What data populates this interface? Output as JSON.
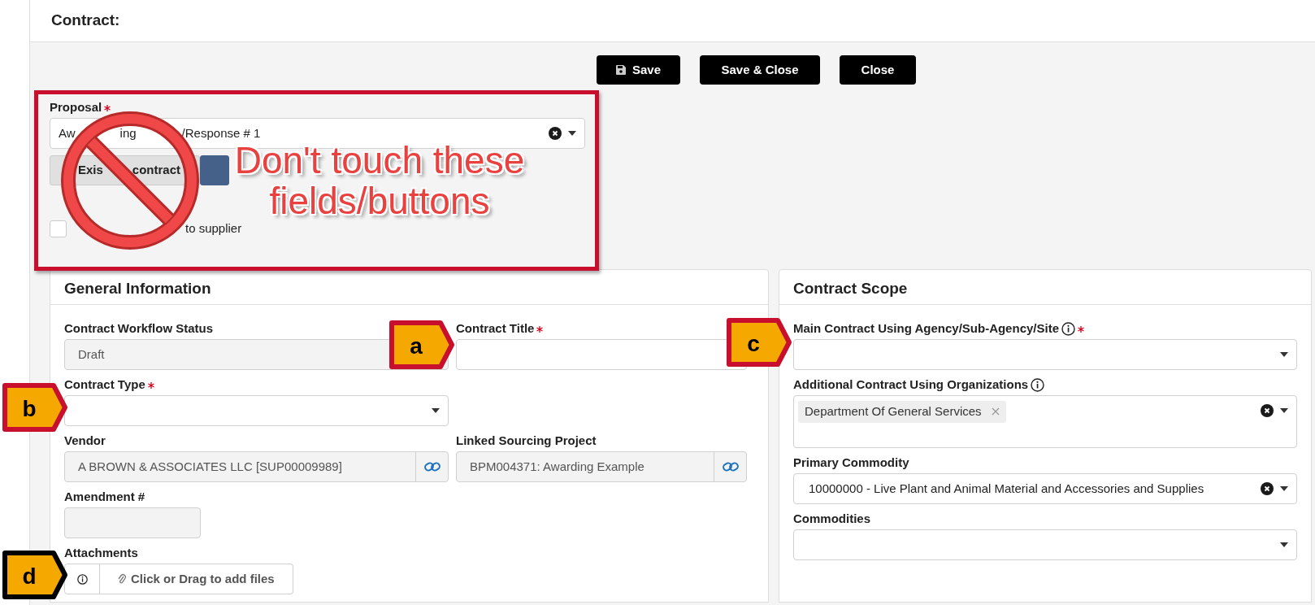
{
  "header": {
    "title": "Contract:"
  },
  "toolbar": {
    "buttons": [
      {
        "label": "Save"
      },
      {
        "label": "Save & Close"
      },
      {
        "label": "Close"
      }
    ]
  },
  "proposal": {
    "label": "Proposal",
    "required": true,
    "value_parts": [
      "Aw",
      "ing",
      "/Response # 1"
    ],
    "clearable": true,
    "mode_buttons": [
      {
        "label_parts": [
          "Exis",
          "contract"
        ],
        "selected": false
      },
      {
        "selected": true
      }
    ],
    "checkbox": {
      "label": "to supplier",
      "checked": false
    }
  },
  "general_information": {
    "title": "General Information",
    "rows": [
      [
        {
          "kind": "text",
          "label": "Contract Workflow Status",
          "value": "Draft",
          "readonly": true
        },
        {
          "kind": "text",
          "label": "Contract Title",
          "required": true,
          "readonly": false
        }
      ],
      [
        {
          "kind": "select",
          "label": "Contract Type",
          "required": true
        }
      ],
      [
        {
          "kind": "link",
          "label": "Vendor",
          "value": "A BROWN & ASSOCIATES LLC [SUP00009989]",
          "readonly": true
        },
        {
          "kind": "link",
          "label": "Linked Sourcing Project",
          "value": "BPM004371: Awarding Example",
          "readonly": true
        }
      ],
      [
        {
          "kind": "short",
          "label": "Amendment #",
          "readonly": true
        }
      ],
      [
        {
          "kind": "upload",
          "label": "Attachments",
          "placeholder": "Click or Drag to add files"
        }
      ]
    ]
  },
  "contract_scope": {
    "title": "Contract Scope",
    "fields": [
      {
        "kind": "select",
        "label": "Main Contract Using Agency/Sub-Agency/Site",
        "info": true,
        "required": true
      },
      {
        "kind": "multiselect",
        "label": "Additional Contract Using Organizations",
        "info": true,
        "tags": [
          "Department Of General Services"
        ],
        "clearable": true
      },
      {
        "kind": "select",
        "label": "Primary Commodity",
        "value": "10000000 - Live Plant and Animal Material and Accessories and Supplies",
        "clearable": true
      },
      {
        "kind": "select",
        "label": "Commodities"
      }
    ]
  },
  "annotation": {
    "message": "Don't touch these fields/buttons",
    "callouts": [
      {
        "label": "a",
        "color": "#c8102e"
      },
      {
        "label": "b",
        "color": "#c8102e"
      },
      {
        "label": "c",
        "color": "#c8102e"
      },
      {
        "label": "d",
        "color": "#000000"
      }
    ]
  }
}
